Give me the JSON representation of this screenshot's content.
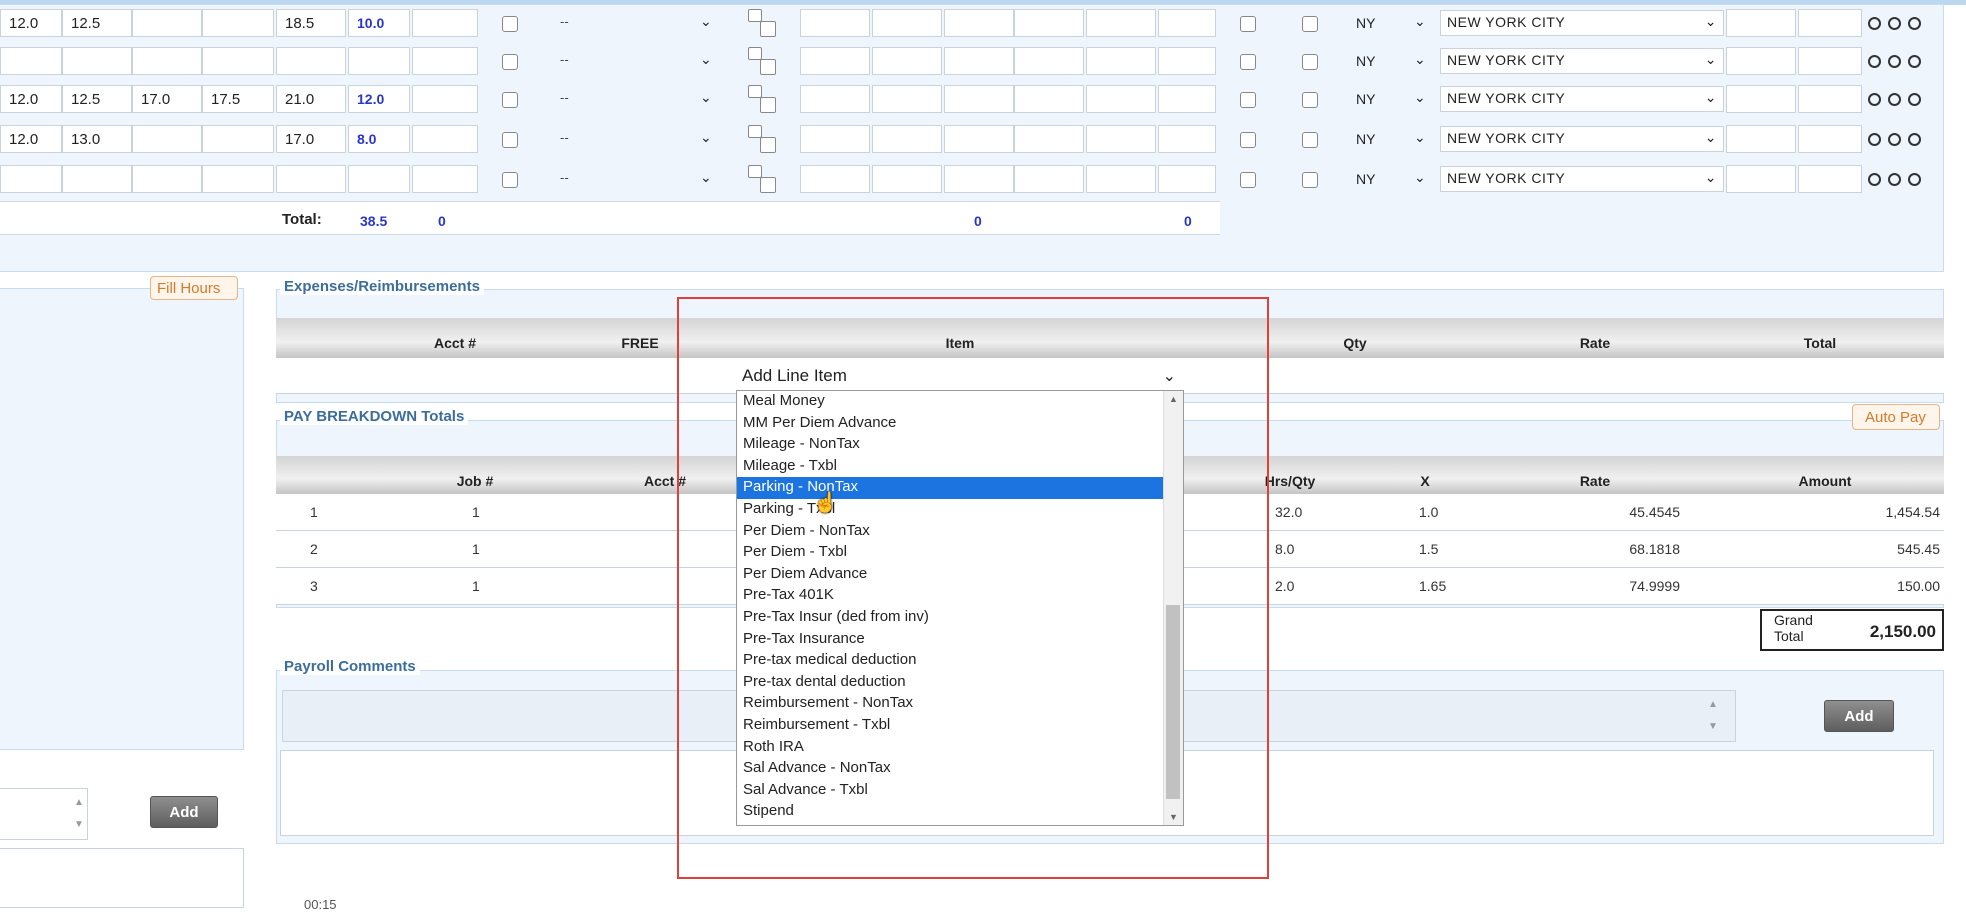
{
  "timesheet": {
    "rows": [
      {
        "c1": "12.0",
        "c2": "12.5",
        "c3": "",
        "c4": "",
        "c5": "18.5",
        "hrs": "10.0",
        "select": "--",
        "state": "NY",
        "city": "NEW YORK CITY"
      },
      {
        "c1": "",
        "c2": "",
        "c3": "",
        "c4": "",
        "c5": "",
        "hrs": "",
        "select": "--",
        "state": "NY",
        "city": "NEW YORK CITY"
      },
      {
        "c1": "12.0",
        "c2": "12.5",
        "c3": "17.0",
        "c4": "17.5",
        "c5": "21.0",
        "hrs": "12.0",
        "select": "--",
        "state": "NY",
        "city": "NEW YORK CITY"
      },
      {
        "c1": "12.0",
        "c2": "13.0",
        "c3": "",
        "c4": "",
        "c5": "17.0",
        "hrs": "8.0",
        "select": "--",
        "state": "NY",
        "city": "NEW YORK CITY"
      },
      {
        "c1": "",
        "c2": "",
        "c3": "",
        "c4": "",
        "c5": "",
        "hrs": "",
        "select": "--",
        "state": "NY",
        "city": "NEW YORK CITY"
      }
    ],
    "total_label": "Total:",
    "total_hours": "38.5",
    "total_b": "0",
    "total_c": "0",
    "total_d": "0"
  },
  "left": {
    "fill_hours_label": "Fill Hours",
    "add_label": "Add"
  },
  "expenses": {
    "title": "Expenses/Reimbursements",
    "columns": [
      "Acct #",
      "FREE",
      "Item",
      "Qty",
      "Rate",
      "Total"
    ],
    "item_select_value": "Add Line Item"
  },
  "dropdown": {
    "options": [
      "Meal Money",
      "MM Per Diem Advance",
      "Mileage - NonTax",
      "Mileage - Txbl",
      "Parking - NonTax",
      "Parking - Txbl",
      "Per Diem - NonTax",
      "Per Diem - Txbl",
      "Per Diem Advance",
      "Pre-Tax 401K",
      "Pre-Tax Insur (ded from inv)",
      "Pre-Tax Insurance",
      "Pre-tax medical deduction",
      "Pre-tax dental deduction",
      "Reimbursement - NonTax",
      "Reimbursement - Txbl",
      "Roth IRA",
      "Sal Advance - NonTax",
      "Sal Advance - Txbl",
      "Stipend"
    ],
    "selected": "Parking - NonTax"
  },
  "pay": {
    "title": "PAY BREAKDOWN Totals",
    "auto_pay_label": "Auto Pay",
    "columns": [
      "Job #",
      "Acct #",
      "Hrs/Qty",
      "X",
      "Rate",
      "Amount"
    ],
    "rows": [
      {
        "n": "1",
        "job": "1",
        "hrs": "32.0",
        "x": "1.0",
        "rate": "45.4545",
        "amount": "1,454.54"
      },
      {
        "n": "2",
        "job": "1",
        "hrs": "8.0",
        "x": "1.5",
        "rate": "68.1818",
        "amount": "545.45"
      },
      {
        "n": "3",
        "job": "1",
        "hrs": "2.0",
        "x": "1.65",
        "rate": "74.9999",
        "amount": "150.00"
      }
    ],
    "grand_total_label": "Grand Total",
    "grand_total_value": "2,150.00"
  },
  "comments": {
    "title": "Payroll Comments",
    "add_label": "Add"
  },
  "footer_partial": "00:15"
}
